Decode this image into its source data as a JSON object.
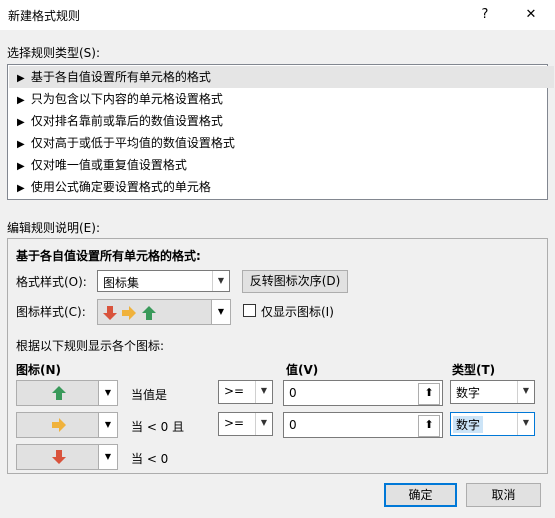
{
  "window": {
    "title": "新建格式规则",
    "help": "?",
    "close": "✕"
  },
  "rule_type": {
    "label": "选择规则类型(S):",
    "items": [
      "基于各自值设置所有单元格的格式",
      "只为包含以下内容的单元格设置格式",
      "仅对排名靠前或靠后的数值设置格式",
      "仅对高于或低于平均值的数值设置格式",
      "仅对唯一值或重复值设置格式",
      "使用公式确定要设置格式的单元格"
    ],
    "selected_index": 0
  },
  "edit": {
    "label": "编辑规则说明(E):",
    "heading": "基于各自值设置所有单元格的格式:",
    "format_style_label": "格式样式(O):",
    "format_style_value": "图标集",
    "reverse_button": "反转图标次序(D)",
    "icon_style_label": "图标样式(C):",
    "show_icon_only_label": "仅显示图标(I)",
    "show_icon_only_checked": false,
    "rules_caption": "根据以下规则显示各个图标:",
    "col_icon": "图标(N)",
    "col_value": "值(V)",
    "col_type": "类型(T)",
    "rows": [
      {
        "icon": "green-up-arrow",
        "condition": "当值是",
        "operator": ">=",
        "value": "0",
        "type": "数字"
      },
      {
        "icon": "yellow-right-arrow",
        "condition": "当 < 0 且",
        "operator": ">=",
        "value": "0",
        "type": "数字"
      },
      {
        "icon": "red-down-arrow",
        "condition": "当 < 0"
      }
    ]
  },
  "buttons": {
    "ok": "确定",
    "cancel": "取消"
  },
  "colors": {
    "green": "#3a9a5b",
    "yellow": "#f0b23c",
    "red": "#d9533c",
    "accent": "#0078d7",
    "selection": "#cce4f7"
  }
}
